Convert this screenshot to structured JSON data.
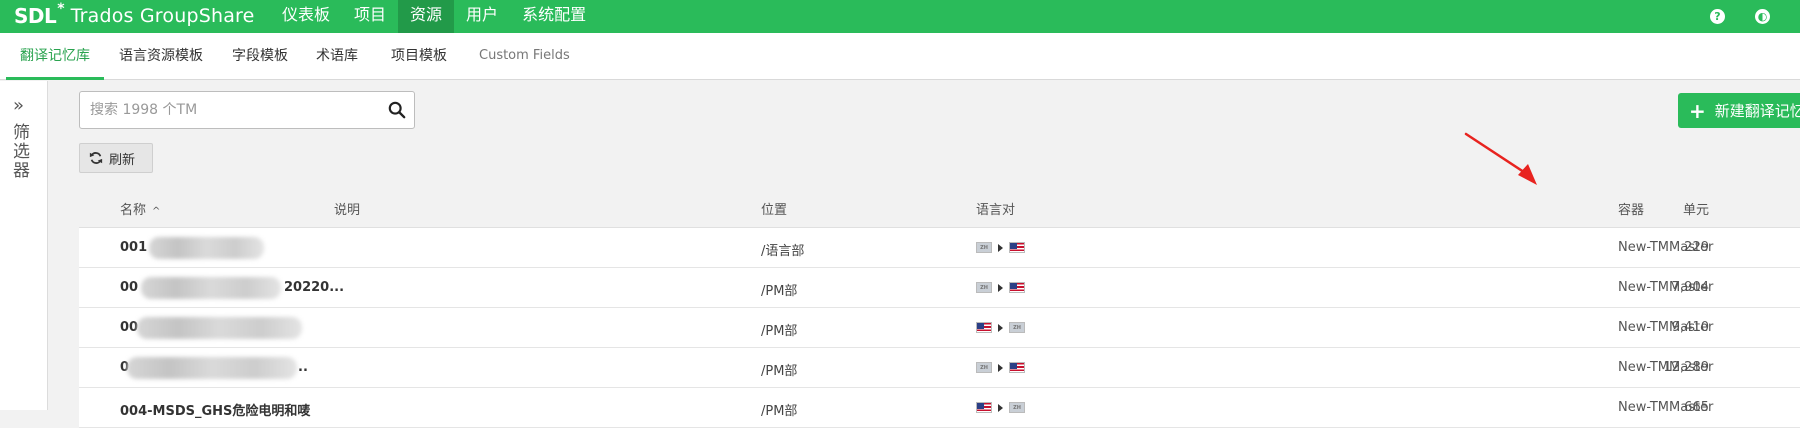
{
  "brand": {
    "sdl": "SDL",
    "star": "*",
    "rest": "Trados GroupShare"
  },
  "topnav": [
    {
      "label": "仪表板",
      "active": false
    },
    {
      "label": "项目",
      "active": false
    },
    {
      "label": "资源",
      "active": true
    },
    {
      "label": "用户",
      "active": false
    },
    {
      "label": "系统配置",
      "active": false
    }
  ],
  "top_right": {
    "help_glyph": "?",
    "globe_glyph": "◐"
  },
  "subnav": [
    {
      "label": "翻译记忆库",
      "active": true
    },
    {
      "label": "语言资源模板",
      "active": false
    },
    {
      "label": "字段模板",
      "active": false
    },
    {
      "label": "术语库",
      "active": false
    },
    {
      "label": "项目模板",
      "active": false
    },
    {
      "label": "Custom Fields",
      "active": false
    }
  ],
  "filter": {
    "chevron": "»",
    "label": "筛选器"
  },
  "search": {
    "placeholder": "搜索 1998 个TM",
    "value": ""
  },
  "refresh_label": "刷新",
  "new_button": {
    "plus": "+",
    "label": "新建翻译记忆库"
  },
  "table": {
    "headers": {
      "name": "名称",
      "description": "说明",
      "location": "位置",
      "language_pair": "语言对",
      "units": "单元",
      "container": "容器"
    },
    "sort_indicator": "^",
    "rows": [
      {
        "name": "001",
        "location": "/语言部",
        "source": "zh",
        "target": "us",
        "units": "229",
        "container": "New-TMMaster"
      },
      {
        "name": "00",
        "name_suffix": "20220...",
        "location": "/PM部",
        "source": "zh",
        "target": "us",
        "units": "7,904",
        "container": "New-TMMaster"
      },
      {
        "name": "00",
        "location": "/PM部",
        "source": "us",
        "target": "zh",
        "units": "9,410",
        "container": "New-TMMaster"
      },
      {
        "name": "0",
        "name_suffix": "..",
        "location": "/PM部",
        "source": "zh",
        "target": "us",
        "units": "12,289",
        "container": "New-TMMaster"
      },
      {
        "name": "004-MSDS_GHS危险电明和唛",
        "location": "/PM部",
        "source": "us",
        "target": "zh",
        "units": "665",
        "container": "New-TMMaster"
      }
    ]
  },
  "colors": {
    "brand_green": "#2abb5a",
    "active_green": "#229a49",
    "annotation_red": "#e8231f"
  }
}
